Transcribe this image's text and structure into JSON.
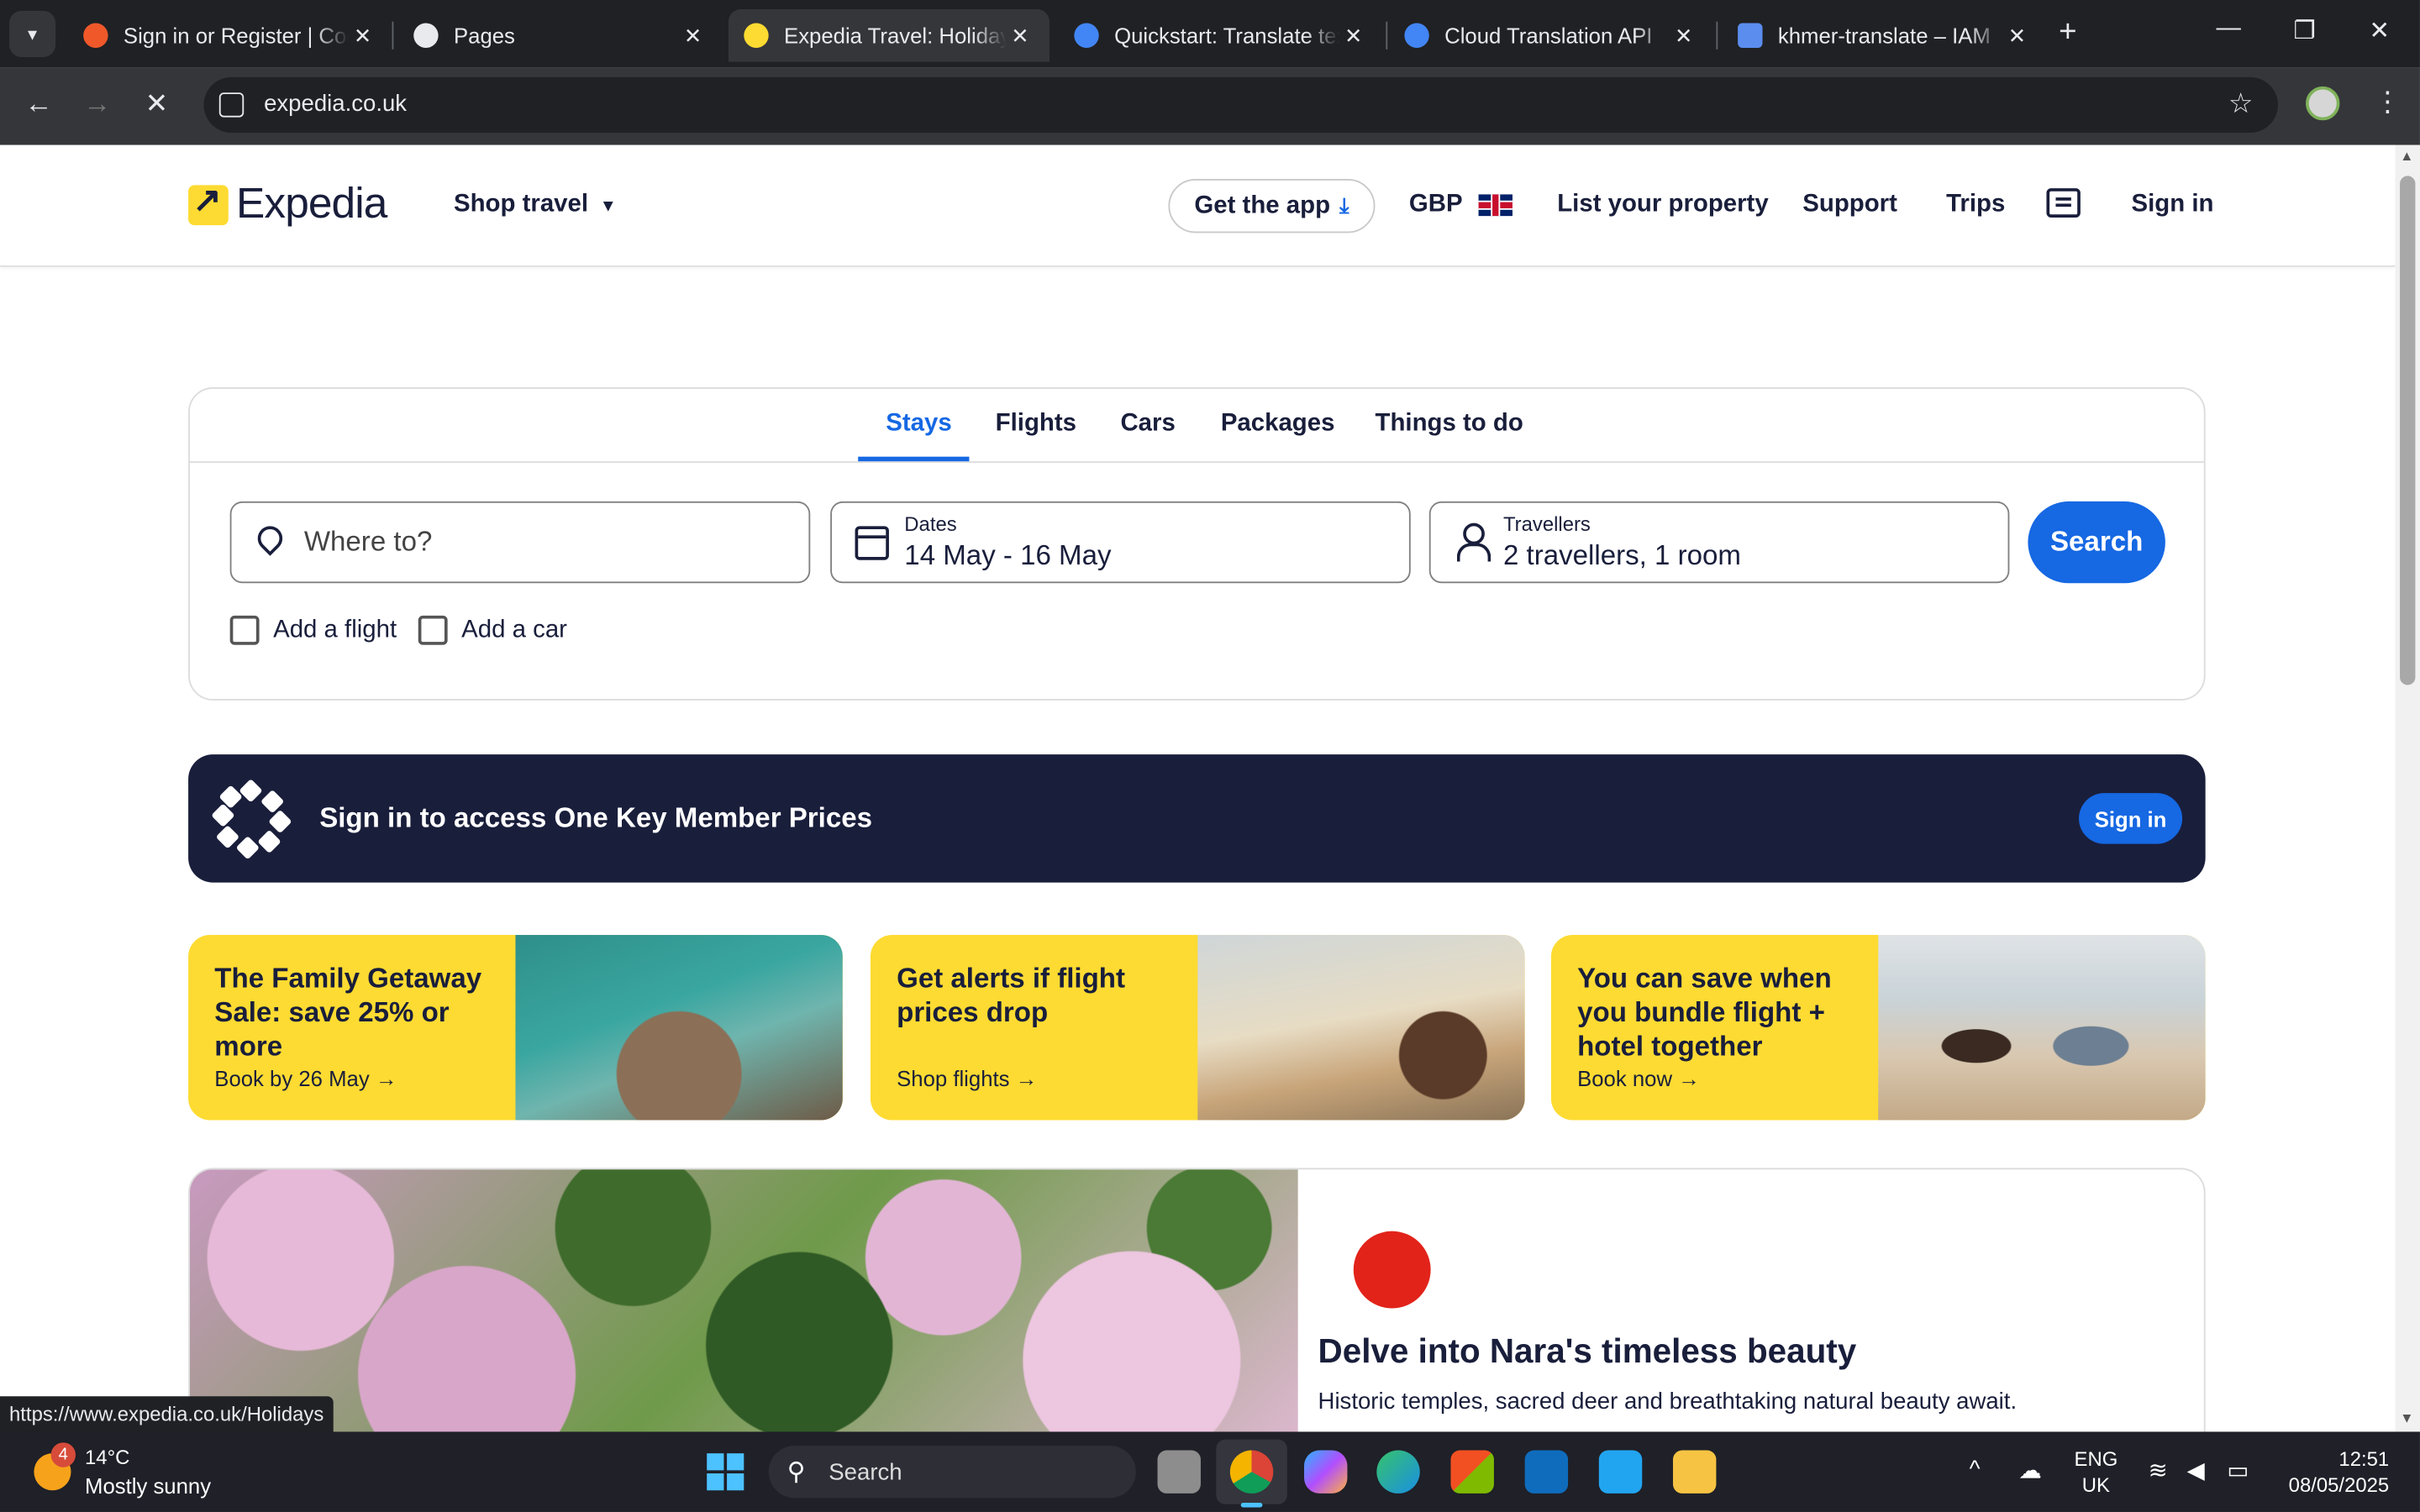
{
  "browser": {
    "tabs": [
      {
        "title": "Sign in or Register | Coc",
        "favicon_color": "#f0582a"
      },
      {
        "title": "Pages",
        "favicon_color": "#e8eaed"
      },
      {
        "title": "Expedia Travel: Holiday",
        "favicon_color": "#fddb32",
        "active": true
      },
      {
        "title": "Quickstart: Translate tex",
        "favicon_color": "#4285f4"
      },
      {
        "title": "Cloud Translation API",
        "favicon_color": "#4285f4"
      },
      {
        "title": "khmer-translate – IAM",
        "favicon_color": "#5b8def"
      }
    ],
    "url": "expedia.co.uk",
    "status_url": "https://www.expedia.co.uk/Holidays"
  },
  "header": {
    "logo_text": "Expedia",
    "shop_travel": "Shop travel",
    "get_app": "Get the app",
    "currency": "GBP",
    "list_property": "List your property",
    "support": "Support",
    "trips": "Trips",
    "sign_in": "Sign in"
  },
  "search": {
    "tabs": [
      "Stays",
      "Flights",
      "Cars",
      "Packages",
      "Things to do"
    ],
    "active_tab": "Stays",
    "destination_placeholder": "Where to?",
    "dates_label": "Dates",
    "dates_value": "14 May - 16 May",
    "travellers_label": "Travellers",
    "travellers_value": "2 travellers, 1 room",
    "search_button": "Search",
    "add_flight": "Add a flight",
    "add_car": "Add a car"
  },
  "onekey": {
    "text": "Sign in to access One Key Member Prices",
    "button": "Sign in"
  },
  "promos": [
    {
      "title": "The Family Getaway Sale: save 25% or more",
      "cta": "Book by 26 May"
    },
    {
      "title": "Get alerts if flight prices drop",
      "cta": "Shop flights"
    },
    {
      "title": "You can save when you bundle flight + hotel together",
      "cta": "Book now"
    }
  ],
  "feature": {
    "title": "Delve into Nara's timeless beauty",
    "subtitle": "Historic temples, sacred deer and breathtaking natural beauty await."
  },
  "taskbar": {
    "weather_badge": "4",
    "temperature": "14°C",
    "condition": "Mostly sunny",
    "search_placeholder": "Search",
    "lang_line1": "ENG",
    "lang_line2": "UK",
    "time": "12:51",
    "date": "08/05/2025"
  },
  "colors": {
    "brand_yellow": "#fddb32",
    "brand_navy": "#191e3b",
    "accent_blue": "#1668e3"
  }
}
